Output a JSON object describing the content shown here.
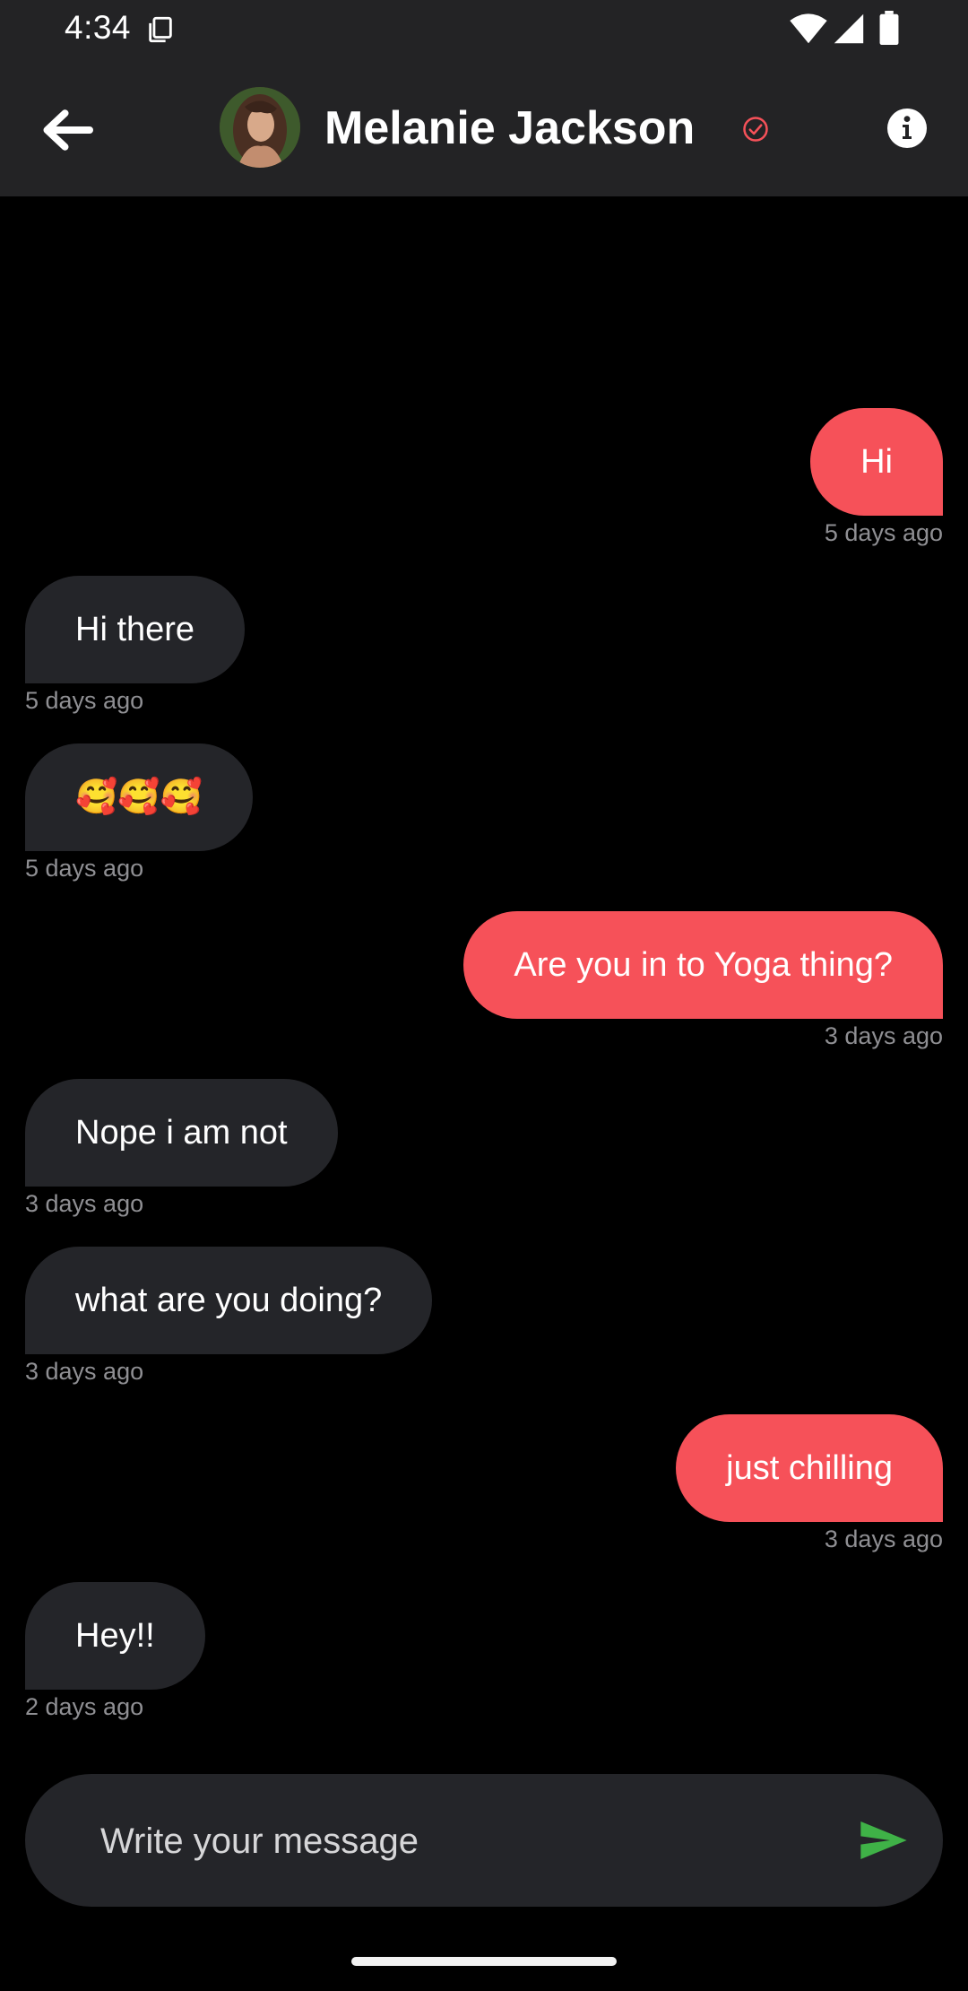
{
  "status_bar": {
    "time": "4:34"
  },
  "header": {
    "contact_name": "Melanie Jackson",
    "icons": {
      "back": "arrow-left-icon",
      "verified": "check-circle-icon",
      "info": "info-icon"
    }
  },
  "messages": [
    {
      "text": "Hi",
      "time": "5 days ago",
      "direction": "out"
    },
    {
      "text": "Hi there",
      "time": "5 days ago",
      "direction": "in"
    },
    {
      "text": "🥰🥰🥰",
      "time": "5 days ago",
      "direction": "in"
    },
    {
      "text": "Are you in to Yoga thing?",
      "time": "3 days ago",
      "direction": "out"
    },
    {
      "text": "Nope i am not",
      "time": "3 days ago",
      "direction": "in"
    },
    {
      "text": "what are you doing?",
      "time": "3 days ago",
      "direction": "in"
    },
    {
      "text": "just chilling",
      "time": "3 days ago",
      "direction": "out"
    },
    {
      "text": "Hey!!",
      "time": "2 days ago",
      "direction": "in"
    }
  ],
  "composer": {
    "placeholder": "Write your message",
    "value": "",
    "send_icon": "send-icon"
  },
  "colors": {
    "outgoing_bubble": "#f65159",
    "incoming_bubble": "#242529",
    "background": "#000000",
    "send_icon": "#3fb247",
    "verified_icon": "#f65159"
  }
}
